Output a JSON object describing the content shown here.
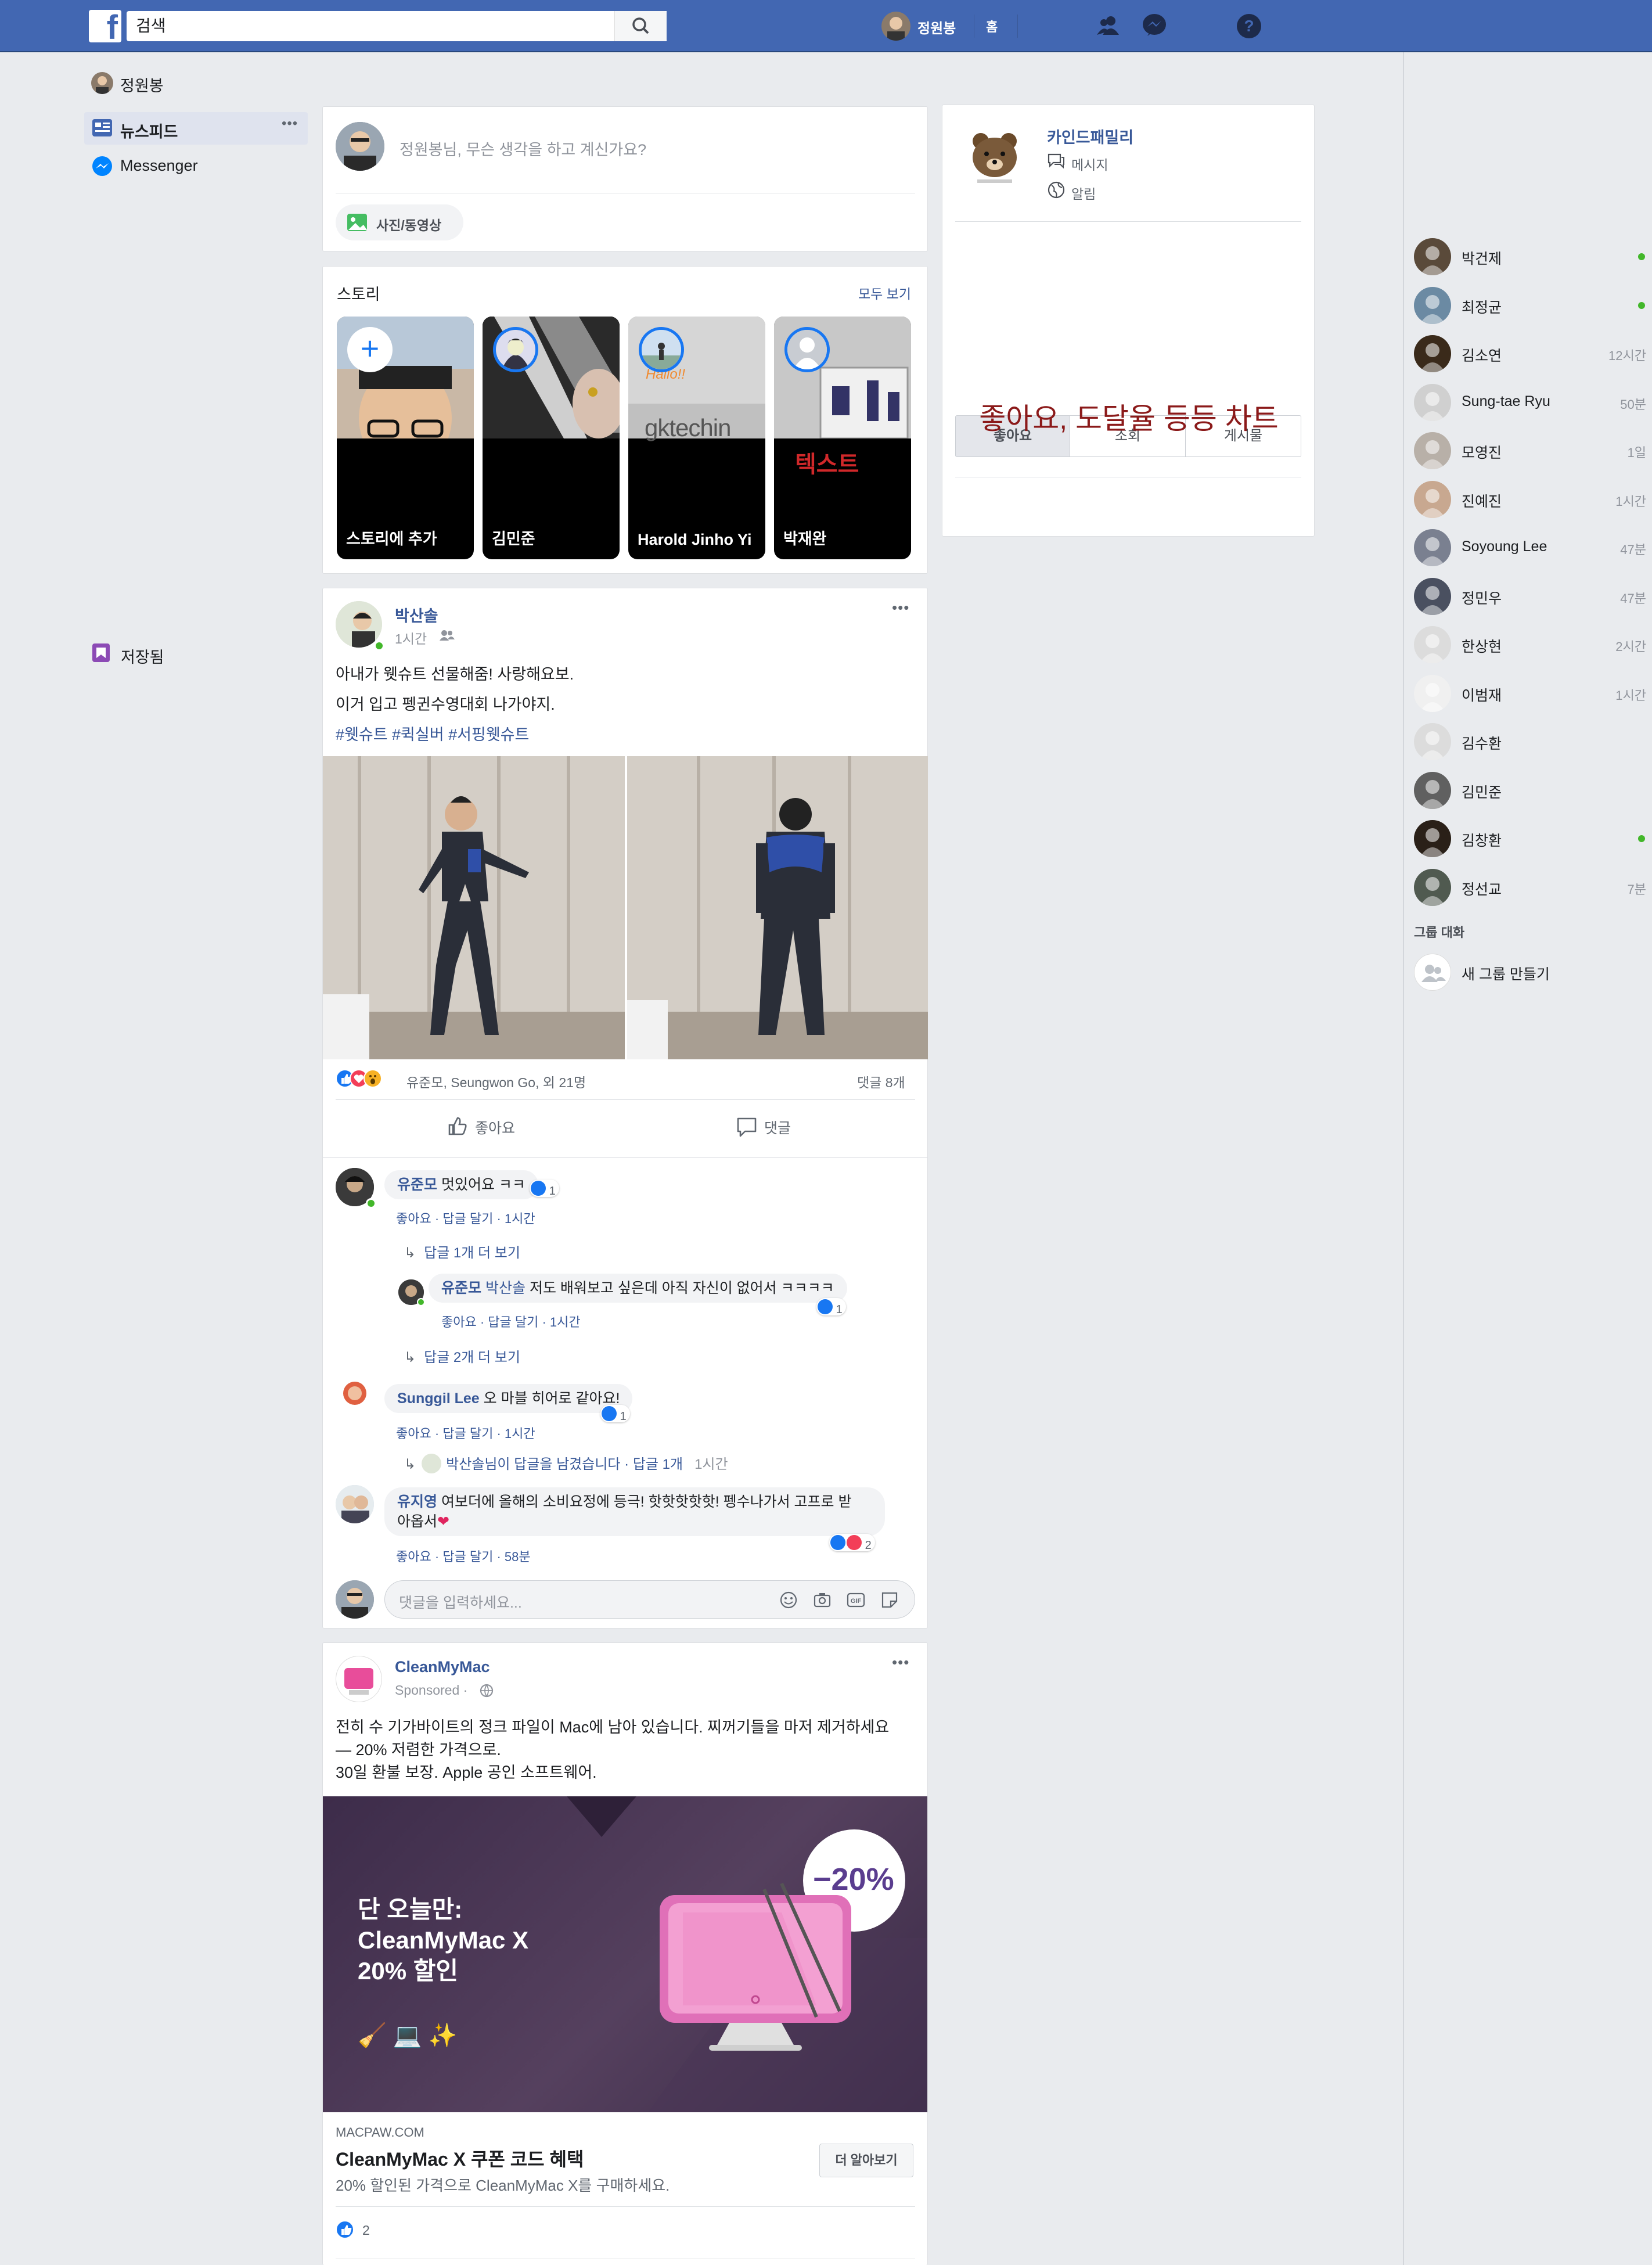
{
  "topbar": {
    "logo": "f",
    "search_placeholder": "검색",
    "user_name": "정원봉",
    "home_label": "홈"
  },
  "left_nav": {
    "profile_name": "정원봉",
    "items": [
      {
        "label": "뉴스피드",
        "icon": "newsfeed-icon"
      },
      {
        "label": "Messenger",
        "icon": "messenger-icon"
      }
    ],
    "saved_label": "저장됨",
    "more": "•••"
  },
  "composer": {
    "placeholder": "정원봉님, 무슨 생각을 하고 계신가요?",
    "photo_button": "사진/동영상"
  },
  "stories": {
    "title": "스토리",
    "see_all": "모두 보기",
    "items": [
      {
        "name": "스토리에 추가"
      },
      {
        "name": "김민준"
      },
      {
        "name": "Harold Jinho Yi",
        "overlay": "Hallo!!",
        "brand": "gktechin"
      },
      {
        "name": "박재완",
        "overlay": "텍스트"
      }
    ]
  },
  "post1": {
    "author": "박산솔",
    "time": "1시간",
    "text_lines": [
      "아내가 웻슈트 선물해줌! 사랑해요보.",
      "이거 입고 펭귄수영대회 나가야지."
    ],
    "hashtags": "#웻슈트 #퀵실버 #서핑웻슈트",
    "reactions_text": "유준모, Seungwon Go, 외 21명",
    "comments_count": "댓글 8개",
    "like_btn": "좋아요",
    "comment_btn": "댓글",
    "comments": [
      {
        "author": "유준모",
        "text": "멋있어요 ㅋㅋ",
        "likes": "1",
        "actions": "좋아요 · 답글 달기 · 1시간"
      },
      {
        "more_replies": "답글 1개 더 보기"
      },
      {
        "author": "유준모",
        "mention": "박산솔",
        "text": "저도 배워보고 싶은데 아직 자신이 없어서 ㅋㅋㅋㅋ",
        "likes": "1",
        "actions": "좋아요 · 답글 달기 · 1시간"
      },
      {
        "more_replies": "답글 2개 더 보기"
      },
      {
        "author": "Sunggil Lee",
        "text": "오 마블 히어로 같아요!",
        "likes": "1",
        "actions": "좋아요 · 답글 달기 · 1시간"
      },
      {
        "reply_summary": "박산솔님이 답글을 남겼습니다 · 답글 1개",
        "reply_time": "1시간"
      },
      {
        "author": "유지영",
        "text_line1": "여보더에 올해의 소비요정에 등극! 핫핫핫핫핫! 펭수나가서 고프로 받",
        "text_line2": "아옵서",
        "likes": "2",
        "actions": "좋아요 · 답글 달기 · 58분"
      }
    ],
    "comment_placeholder": "댓글을 입력하세요...",
    "more": "•••"
  },
  "post2": {
    "author": "CleanMyMac",
    "sponsored": "Sponsored ·",
    "text_lines": [
      "전히 수 기가바이트의 정크 파일이 Mac에 남아 있습니다. 찌꺼기들을 마저 제거하세요",
      "— 20% 저렴한 가격으로.",
      "30일 환불 보장. Apple 공인 소프트웨어."
    ],
    "ad_headline": [
      "단 오늘만:",
      "CleanMyMac X",
      "20% 할인"
    ],
    "ad_emojis": "🧹 💻 ✨",
    "discount": "−20%",
    "domain": "MACPAW.COM",
    "title": "CleanMyMac X 쿠폰 코드 혜택",
    "desc": "20% 할인된 가격으로 CleanMyMac X를 구매하세요.",
    "cta": "더 알아보기",
    "likes": "2",
    "more": "•••"
  },
  "page_panel": {
    "name": "카인드패밀리",
    "message": "메시지",
    "notifications": "알림",
    "tabs": [
      "좋아요",
      "조회",
      "게시물"
    ],
    "chart_text": "좋아요, 도달율 등등 차트"
  },
  "chat_sidebar": {
    "contacts": [
      {
        "name": "박건제",
        "time": "",
        "online": true,
        "color": "#5a4a3a"
      },
      {
        "name": "최정균",
        "time": "",
        "online": true,
        "color": "#6b8aa3"
      },
      {
        "name": "김소연",
        "time": "12시간",
        "online": false,
        "color": "#3a2a1a"
      },
      {
        "name": "Sung-tae Ryu",
        "time": "50분",
        "online": false,
        "color": "#d0d0d0"
      },
      {
        "name": "모영진",
        "time": "1일",
        "online": false,
        "color": "#b8b0a8"
      },
      {
        "name": "진예진",
        "time": "1시간",
        "online": false,
        "color": "#c8a890"
      },
      {
        "name": "Soyoung Lee",
        "time": "47분",
        "online": false,
        "color": "#7a8090"
      },
      {
        "name": "정민우",
        "time": "47분",
        "online": false,
        "color": "#4a5060"
      },
      {
        "name": "한상현",
        "time": "2시간",
        "online": false,
        "color": "#dcdcdc"
      },
      {
        "name": "이범재",
        "time": "1시간",
        "online": false,
        "color": "#f0f0f0"
      },
      {
        "name": "김수환",
        "time": "",
        "online": false,
        "color": "#dcdcdc"
      },
      {
        "name": "김민준",
        "time": "",
        "online": false,
        "color": "#606060"
      },
      {
        "name": "김창환",
        "time": "",
        "online": true,
        "color": "#2a2018"
      },
      {
        "name": "정선교",
        "time": "7분",
        "online": false,
        "color": "#505a50"
      }
    ],
    "group_title": "그룹 대화",
    "new_group": "새 그룹 만들기"
  },
  "colors": {
    "brand": "#4267b2",
    "link": "#385898",
    "online": "#42b72a",
    "like_blue": "#1877f2",
    "love_red": "#f33e58",
    "chart_text": "#8b1a1a"
  }
}
